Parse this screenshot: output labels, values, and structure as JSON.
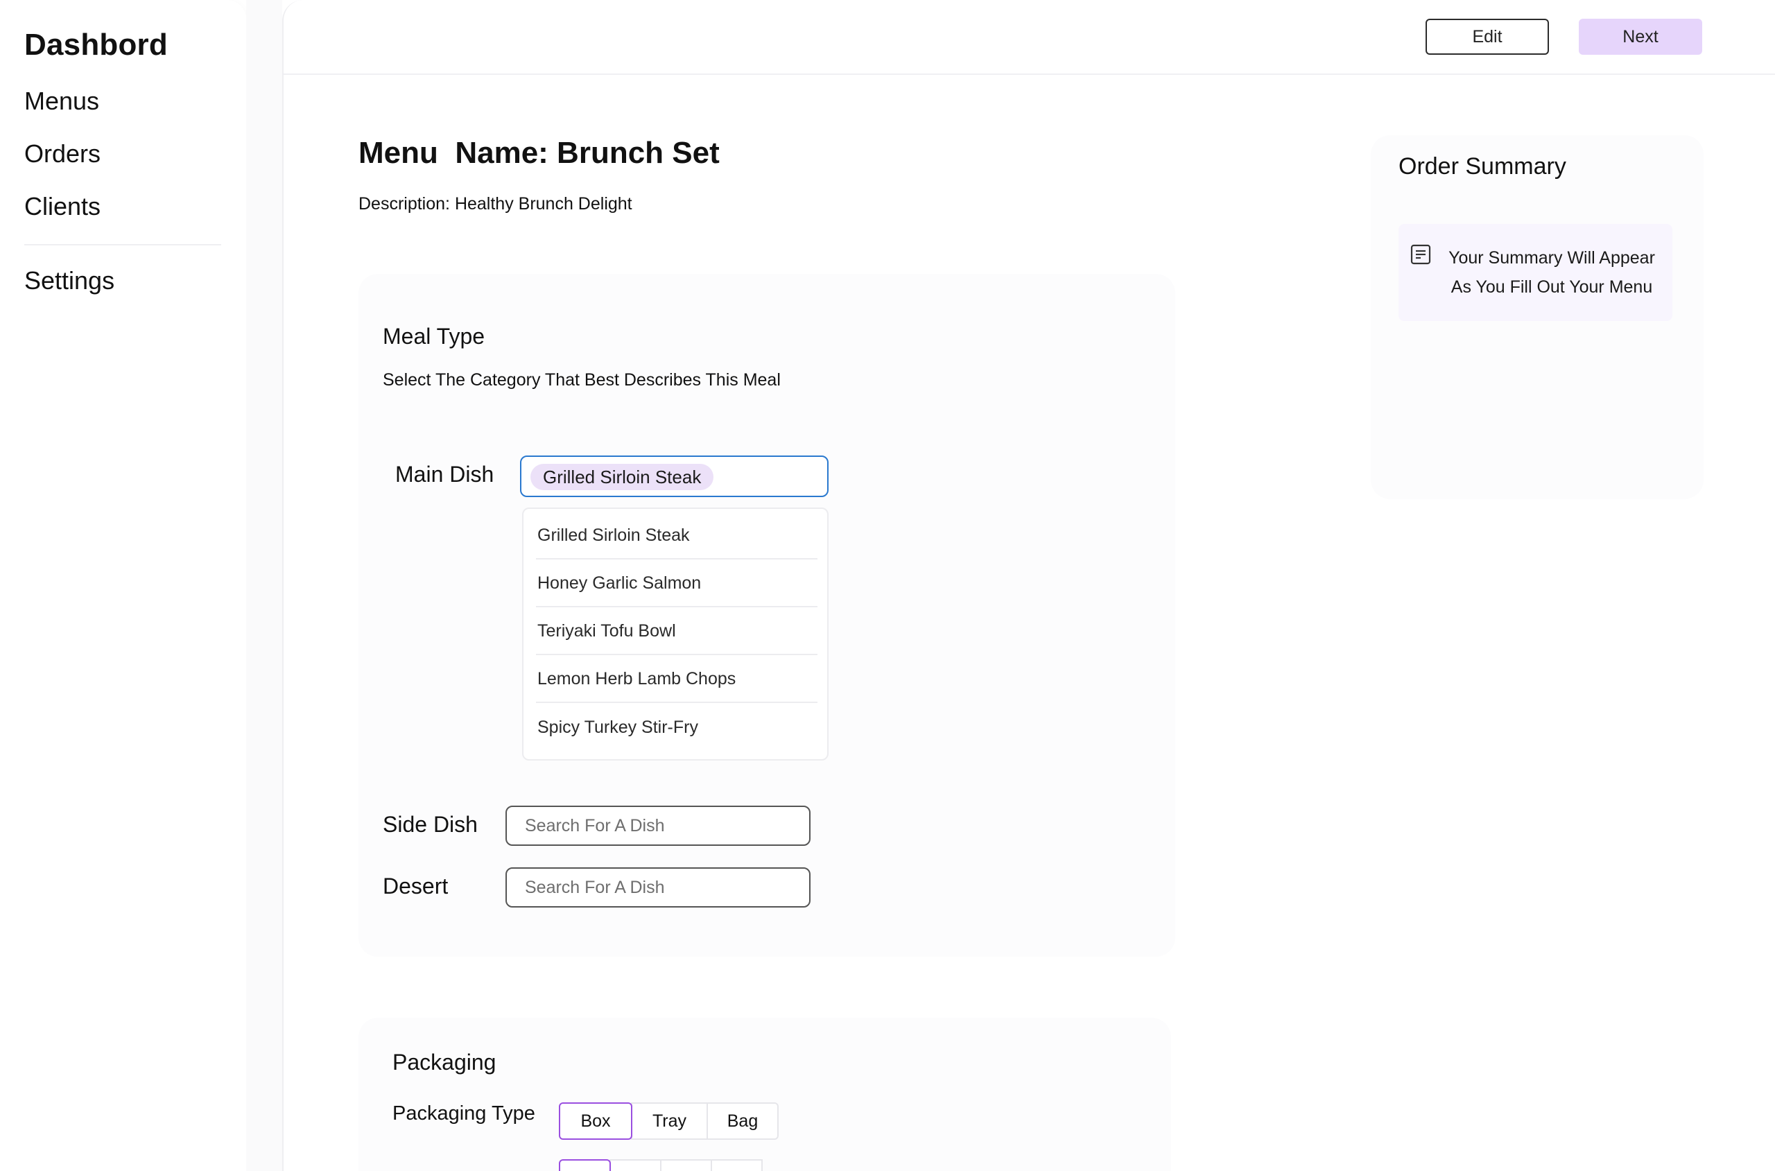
{
  "sidebar": {
    "brand": "Dashbord",
    "items": [
      {
        "label": "Menus"
      },
      {
        "label": "Orders"
      },
      {
        "label": "Clients"
      },
      {
        "label": "Settings"
      }
    ]
  },
  "toolbar": {
    "edit_label": "Edit",
    "next_label": "Next"
  },
  "menu": {
    "title": "Menu  Name: Brunch Set",
    "description": "Description: Healthy Brunch Delight"
  },
  "meal_type": {
    "title": "Meal Type",
    "subtitle": "Select The Category That Best Describes This Meal",
    "main_dish_label": "Main Dish",
    "main_dish_selected": "Grilled Sirloin Steak",
    "options": [
      "Grilled Sirloin Steak",
      "Honey Garlic Salmon",
      "Teriyaki Tofu Bowl",
      "Lemon Herb Lamb Chops",
      "Spicy Turkey Stir-Fry"
    ],
    "side_dish_label": "Side Dish",
    "side_dish_placeholder": "Search For A Dish",
    "desert_label": "Desert",
    "desert_placeholder": "Search For A Dish"
  },
  "packaging": {
    "title": "Packaging",
    "type_label": "Packaging Type",
    "types": [
      "Box",
      "Tray",
      "Bag"
    ],
    "selected_type": "Box"
  },
  "summary": {
    "title": "Order Summary",
    "empty_text": "Your Summary Will Appear As You Fill Out Your Menu"
  },
  "colors": {
    "accent": "#9a4fe0",
    "next_bg": "#e6d5fb",
    "chip_bg": "#ece1f8",
    "focus_border": "#2a79cf"
  }
}
